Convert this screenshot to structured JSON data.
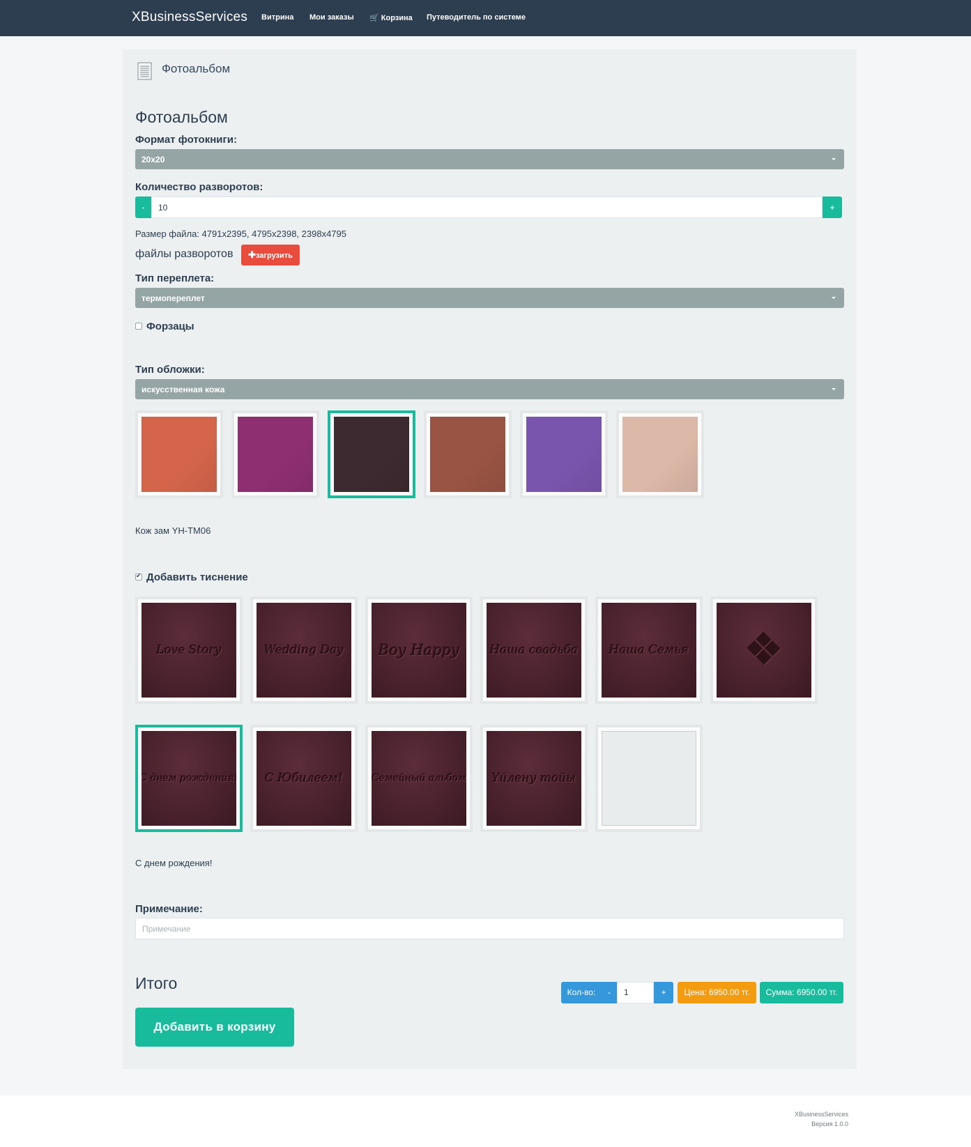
{
  "navbar": {
    "brand": "XBusinessServices",
    "items": [
      {
        "label": "Витрина"
      },
      {
        "label": "Мои заказы"
      },
      {
        "label": "Корзина",
        "icon": "cart-icon"
      },
      {
        "label": "Путеводитель по системе"
      }
    ]
  },
  "header": {
    "icon": "document-icon",
    "title": "Фотоальбом"
  },
  "form": {
    "title": "Фотоальбом",
    "format": {
      "label": "Формат фотокниги:",
      "value": "20x20"
    },
    "spreads": {
      "label": "Количество разворотов:",
      "minus": "-",
      "value": "10",
      "plus": "+"
    },
    "file_size": "Размер файла: 4791x2395, 4795x2398, 2398x4795",
    "spread_files": {
      "label": "файлы разворотов",
      "upload_button": "загрузить",
      "upload_icon": "plus-icon"
    },
    "binding": {
      "label": "Тип переплета:",
      "value": "термопереплет"
    },
    "endpapers": {
      "label": "Форзацы",
      "checked": false
    },
    "cover": {
      "label": "Тип обложки:",
      "value": "искусственная кожа",
      "swatches": [
        {
          "color": "#d4654b",
          "selected": false
        },
        {
          "color": "#8e2f72",
          "selected": false
        },
        {
          "color": "#3d2a30",
          "selected": true
        },
        {
          "color": "#9a5443",
          "selected": false
        },
        {
          "color": "#7a55ad",
          "selected": false
        },
        {
          "color": "#dcb8a8",
          "selected": false
        }
      ],
      "selected_name": "Кож зам YH-TM06"
    },
    "embossing": {
      "label": "Добавить тиснение",
      "checked": true,
      "options": [
        {
          "text": "Love Story",
          "selected": false
        },
        {
          "text": "Wedding Day",
          "selected": false
        },
        {
          "text": "Boy Happy",
          "selected": false
        },
        {
          "text": "Наша свадьба",
          "selected": false
        },
        {
          "text": "Наша Семья",
          "selected": false
        },
        {
          "text": "",
          "ornament": "ornament-icon",
          "selected": false
        },
        {
          "text": "С днем рождения!",
          "selected": true
        },
        {
          "text": "С Юбилеем!",
          "selected": false
        },
        {
          "text": "Семейный альбом",
          "selected": false
        },
        {
          "text": "Үйлену тойы",
          "selected": false
        },
        {
          "text": "",
          "empty": true,
          "selected": false
        }
      ],
      "selected_name": "С днем рождения!"
    },
    "note": {
      "label": "Примечание:",
      "placeholder": "Примечание",
      "value": ""
    }
  },
  "summary": {
    "title": "Итого",
    "qty_label": "Кол-во:",
    "qty_minus": "-",
    "qty_value": "1",
    "qty_plus": "+",
    "price": "Цена: 6950.00 тг.",
    "total": "Сумма: 6950.00 тг.",
    "add_to_cart": "Добавить в корзину",
    "colors": {
      "qty": "#3498db",
      "price": "#f39c12",
      "total": "#18bc9c"
    }
  },
  "footer": {
    "company": "XBusinessServices",
    "version": "Версия 1.0.0"
  }
}
